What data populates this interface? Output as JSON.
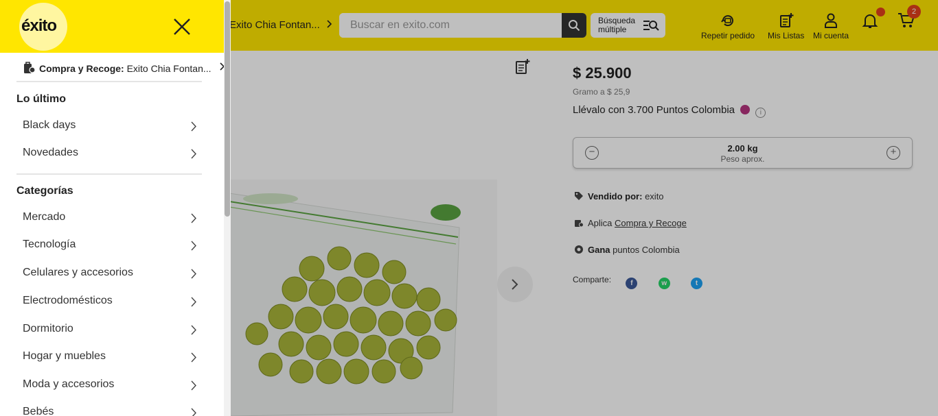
{
  "header": {
    "store_link": "Exito Chia Fontan...",
    "search_placeholder": "Buscar en exito.com",
    "multi_search_line1": "Búsqueda",
    "multi_search_line2": "múltiple",
    "nav": [
      {
        "label": "Repetir pedido",
        "icon": "repeat-order-icon"
      },
      {
        "label": "Mis Listas",
        "icon": "list-icon"
      },
      {
        "label": "Mi cuenta",
        "icon": "user-icon"
      }
    ],
    "cart_count": "2"
  },
  "product": {
    "price": "$ 25.900",
    "unit_price": "Gramo a $ 25,9",
    "points_prefix": "Llévalo con",
    "points_value": "3.700",
    "points_suffix": "Puntos Colombia",
    "quantity": "2.00 kg",
    "quantity_note": "Peso aprox.",
    "sold_by_label": "Vendido por:",
    "sold_by_value": "exito",
    "applies_label": "Aplica",
    "applies_link": "Compra y Recoge",
    "earn_label": "Gana",
    "earn_value": "puntos Colombia",
    "share_label": "Comparte:"
  },
  "drawer": {
    "logo": "éxito",
    "pickup_label": "Compra y Recoge:",
    "pickup_store": "Exito Chia Fontan...",
    "section_latest": "Lo último",
    "latest_items": [
      "Black days",
      "Novedades"
    ],
    "section_categories": "Categorías",
    "category_items": [
      "Mercado",
      "Tecnología",
      "Celulares y accesorios",
      "Electrodomésticos",
      "Dormitorio",
      "Hogar y muebles",
      "Moda y accesorios",
      "Bebés"
    ]
  },
  "colors": {
    "brand_yellow": "#ffe600",
    "badge_red": "#e2401b",
    "points_magenta": "#b6347f"
  }
}
